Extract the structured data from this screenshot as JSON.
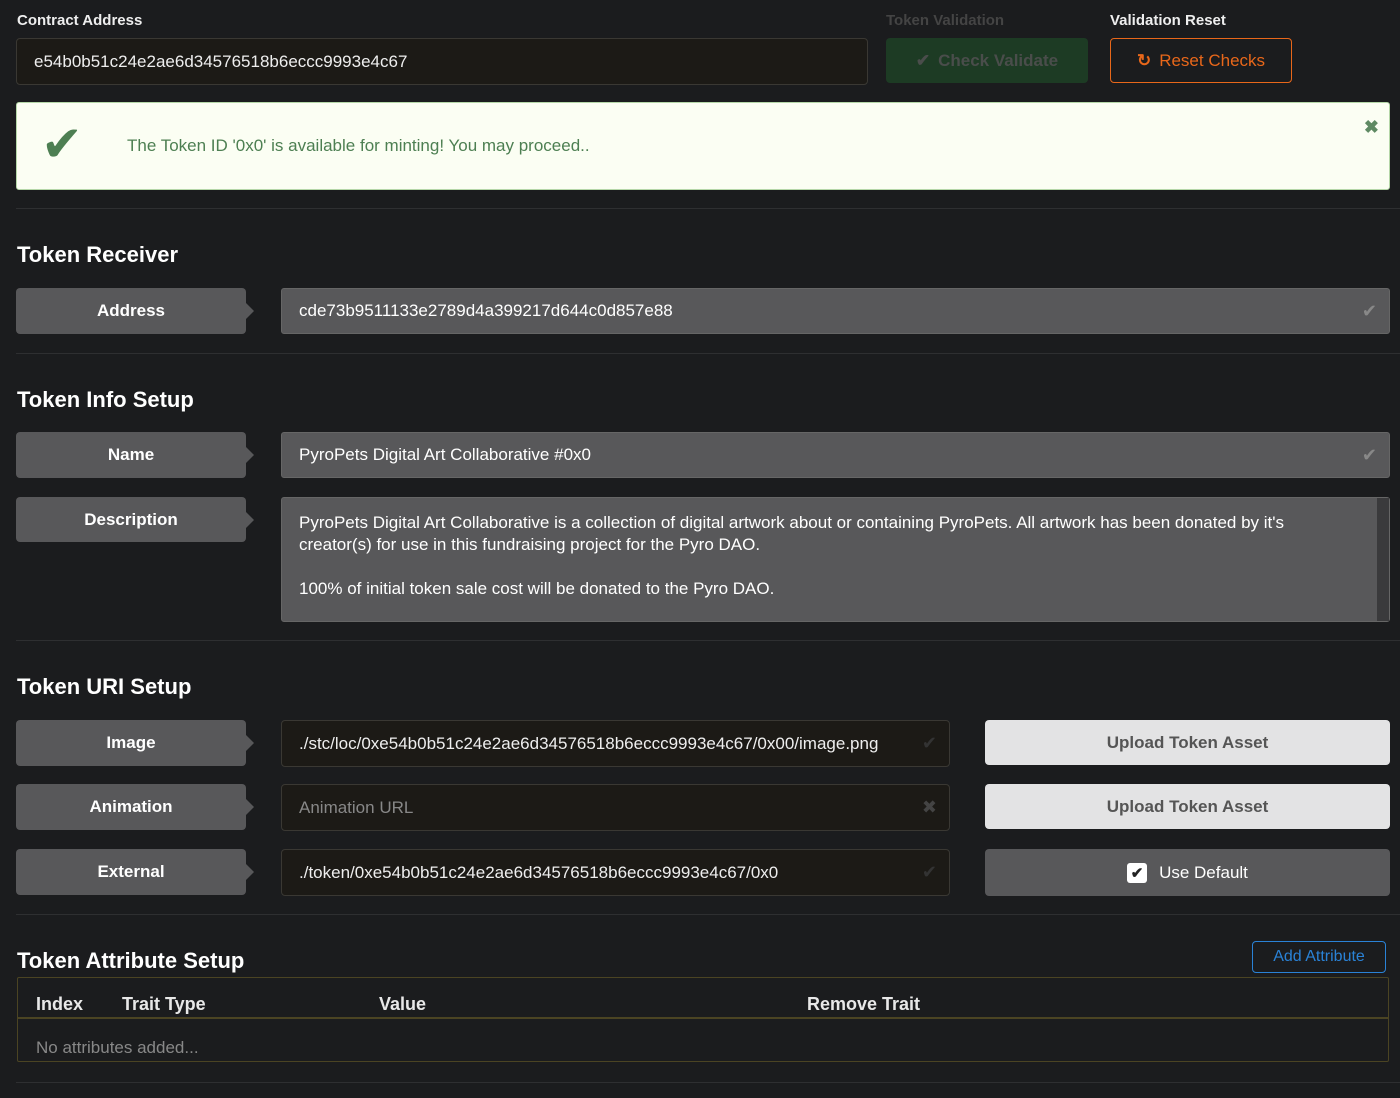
{
  "contract": {
    "label": "Contract Address",
    "value": "e54b0b51c24e2ae6d34576518b6eccc9993e4c67"
  },
  "validation": {
    "label": "Token Validation",
    "button": "Check Validate",
    "icon": "check-icon"
  },
  "reset": {
    "label": "Validation Reset",
    "button": "Reset Checks",
    "icon": "redo-icon",
    "color": "#e8671a"
  },
  "alert": {
    "message": "The Token ID '0x0' is available for minting! You may proceed..",
    "icon": "check-icon",
    "close_icon": "close-icon",
    "color": "#4d7f52"
  },
  "receiver": {
    "title": "Token Receiver",
    "address_label": "Address",
    "address_value": "cde73b9511133e2789d4a399217d644c0d857e88"
  },
  "info": {
    "title": "Token Info Setup",
    "name_label": "Name",
    "name_value": "PyroPets Digital Art Collaborative #0x0",
    "description_label": "Description",
    "description_p1": "PyroPets Digital Art Collaborative is a collection of digital artwork about or containing PyroPets. All artwork has been donated by it's creator(s) for use in this fundraising project for the Pyro DAO.",
    "description_p2": "100% of initial token sale cost will be donated to the Pyro DAO."
  },
  "uri": {
    "title": "Token URI Setup",
    "image_label": "Image",
    "image_value": "./stc/loc/0xe54b0b51c24e2ae6d34576518b6eccc9993e4c67/0x00/image.png",
    "animation_label": "Animation",
    "animation_placeholder": "Animation URL",
    "external_label": "External",
    "external_value": "./token/0xe54b0b51c24e2ae6d34576518b6eccc9993e4c67/0x0",
    "upload_label": "Upload Token Asset",
    "use_default_label": "Use Default",
    "use_default_checked": true
  },
  "attributes": {
    "title": "Token Attribute Setup",
    "add_button": "Add Attribute",
    "columns": [
      "Index",
      "Trait Type",
      "Value",
      "Remove Trait"
    ],
    "empty": "No attributes added..."
  }
}
